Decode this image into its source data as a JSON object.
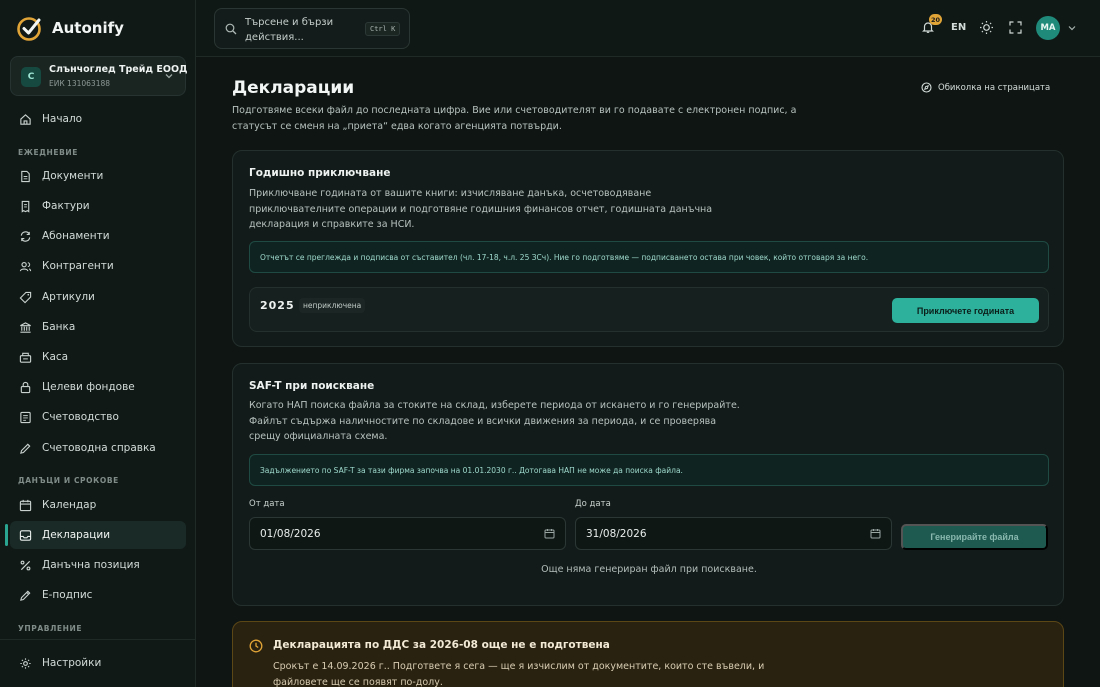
{
  "brand": {
    "name": "Autonify"
  },
  "company": {
    "initial": "С",
    "name": "Слънчоглед Трейд ЕООД",
    "id": "ЕИК 131063188"
  },
  "nav": {
    "home": "Начало",
    "section_daily": "ЕЖЕДНЕВИЕ",
    "documents": "Документи",
    "invoices": "Фактури",
    "subscriptions": "Абонаменти",
    "contractors": "Контрагенти",
    "articles": "Артикули",
    "bank": "Банка",
    "cash": "Каса",
    "funds": "Целеви фондове",
    "accounting": "Счетоводство",
    "accounting_report": "Счетоводна справка",
    "section_taxes": "ДАНЪЦИ И СРОКОВЕ",
    "calendar": "Календар",
    "declarations": "Декларации",
    "tax_position": "Данъчна позиция",
    "esign": "Е-подпис",
    "section_manage": "УПРАВЛЕНИЕ",
    "settings": "Настройки"
  },
  "topbar": {
    "search_placeholder": "Търсене и бързи действия...",
    "shortcut": "Ctrl K",
    "notifications_count": "20",
    "language": "EN",
    "user_initials": "МА"
  },
  "page": {
    "title": "Декларации",
    "tour": "Обиколка на страницата",
    "description": "Подготвяме всеки файл до последната цифра. Вие или счетоводителят ви го подавате с електронен подпис, а статусът се сменя на „приета“ едва когато агенцията потвърди."
  },
  "annual": {
    "title": "Годишно приключване",
    "description": "Приключване годината от вашите книги: изчисляване данъка, осчетоводяване приключвателните операции и подготвяне годишния финансов отчет, годишната данъчна декларация и справките за НСИ.",
    "note": "Отчетът се преглежда и подписва от съставител (чл. 17-18, ч.л. 25 ЗСч). Ние го подготвяме — подписването остава при човек, който отговаря за него.",
    "year": "2025",
    "status": "неприключена",
    "button": "Приключете годината"
  },
  "saft": {
    "title": "SAF-T при поискване",
    "description": "Когато НАП поиска файла за стоките на склад, изберете периода от искането и го генерирайте. Файлът съдържа наличностите по складове и всички движения за периода, и се проверява срещу официалната схема.",
    "note": "Задължението по SAF-T за тази фирма започва на 01.01.2030 г.. Дотогава НАП не може да поиска файла.",
    "from_label": "От дата",
    "from_value": "01/08/2026",
    "to_label": "До дата",
    "to_value": "31/08/2026",
    "button": "Генерирайте файла",
    "empty": "Още няма генериран файл при поискване."
  },
  "alert": {
    "title": "Декларацията по ДДС за 2026-08 още не е подготвена",
    "text": "Срокът е 14.09.2026 г.. Подгответе я сега — ще я изчислим от документите, които сте въвели, и файловете ще се появят по-долу."
  },
  "colors": {
    "accent": "#2eb19c",
    "warning": "#e0a437",
    "background": "#0e1513"
  }
}
